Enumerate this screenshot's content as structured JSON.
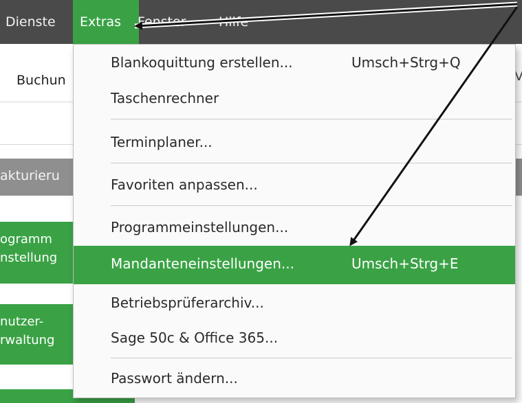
{
  "menubar": {
    "items": [
      "Dienste",
      "Extras",
      "Fenster",
      "Hilfe"
    ],
    "active": "Extras"
  },
  "toolbar": {
    "item_partial": "Buchun",
    "right_partial": "V"
  },
  "section_bar": {
    "label_partial": "akturieru"
  },
  "side_buttons": [
    {
      "line1": "ogramm",
      "line2": "nstellung"
    },
    {
      "line1": "nutzer-",
      "line2": "rwaltung"
    }
  ],
  "extras_menu": {
    "items": [
      {
        "label": "Blankoquittung erstellen...",
        "shortcut": "Umsch+Strg+Q"
      },
      {
        "label": "Taschenrechner",
        "shortcut": ""
      },
      {
        "label": "Terminplaner...",
        "shortcut": ""
      },
      {
        "label": "Favoriten anpassen...",
        "shortcut": ""
      },
      {
        "label": "Programmeinstellungen...",
        "shortcut": ""
      },
      {
        "label": "Mandanteneinstellungen...",
        "shortcut": "Umsch+Strg+E"
      },
      {
        "label": "Betriebsprüferarchiv...",
        "shortcut": ""
      },
      {
        "label": "Sage 50c & Office 365...",
        "shortcut": ""
      },
      {
        "label": "Passwort ändern...",
        "shortcut": ""
      }
    ],
    "highlighted": "Mandanteneinstellungen..."
  },
  "colors": {
    "menubar_bg": "#4a4a4a",
    "accent_green": "#3aa245",
    "section_gray": "#8f8f8f"
  }
}
